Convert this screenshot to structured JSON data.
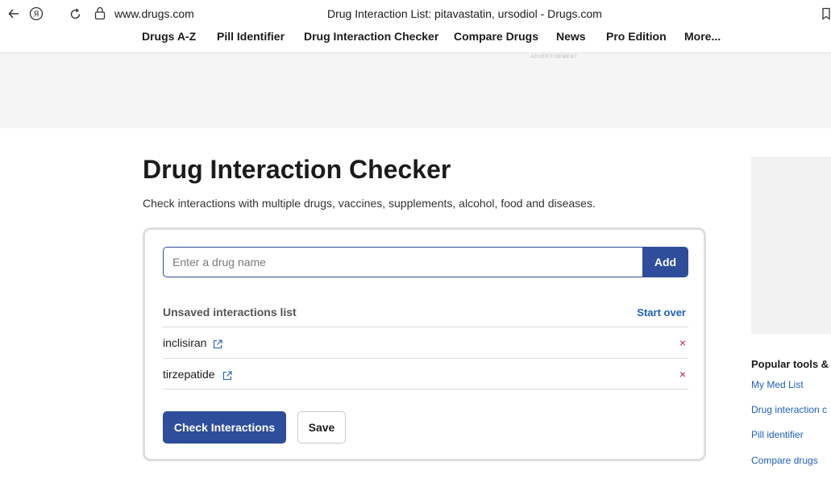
{
  "browser": {
    "url": "www.drugs.com",
    "title": "Drug Interaction List: pitavastatin, ursodiol - Drugs.com",
    "icons": [
      "back-arrow-icon",
      "yandex-icon",
      "reload-icon",
      "lock-icon",
      "bookmark-icon"
    ]
  },
  "nav": {
    "items": [
      "Drugs A-Z",
      "Pill Identifier",
      "Drug Interaction Checker",
      "Compare Drugs",
      "News",
      "Pro Edition",
      "More..."
    ]
  },
  "ad": {
    "label": "ADVERTISEMENT"
  },
  "main": {
    "title": "Drug Interaction Checker",
    "subtitle": "Check interactions with multiple drugs, vaccines, supplements, alcohol, food and diseases."
  },
  "checker": {
    "search_placeholder": "Enter a drug name",
    "add_label": "Add",
    "list_header": "Unsaved interactions list",
    "start_over": "Start over",
    "drugs": [
      {
        "name": "inclisiran",
        "remove": "×"
      },
      {
        "name": "tirzepatide",
        "remove": "×"
      }
    ],
    "check_label": "Check Interactions",
    "save_label": "Save"
  },
  "rail": {
    "heading": "Popular tools &",
    "links": [
      "My Med List",
      "Drug interaction c",
      "Pill identifier",
      "Compare drugs"
    ]
  },
  "colors": {
    "primary": "#2e4d9a",
    "link": "#1d5fb8",
    "remove": "#c2185b",
    "ad_bg": "#f5f5f5"
  }
}
